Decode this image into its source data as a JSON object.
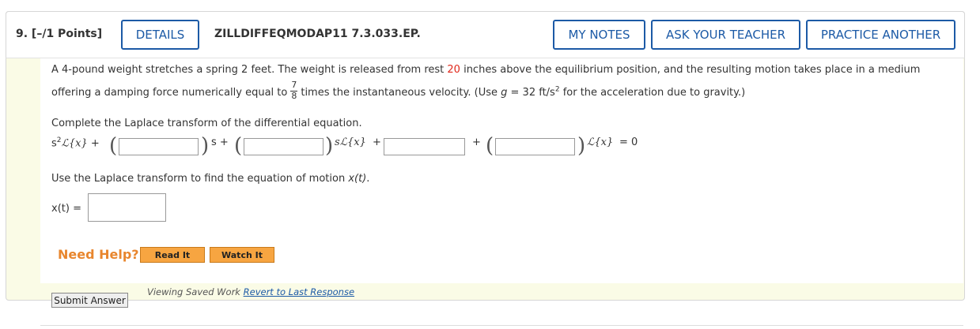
{
  "header": {
    "question_number": "9.  [–/1 Points]",
    "details_label": "DETAILS",
    "problem_code": "ZILLDIFFEQMODAP11 7.3.033.EP.",
    "my_notes_label": "MY NOTES",
    "ask_teacher_label": "ASK YOUR TEACHER",
    "practice_label": "PRACTICE ANOTHER"
  },
  "problem": {
    "line1_a": "A 4-pound weight stretches a spring 2 feet. The weight is released from rest ",
    "line1_value": "20",
    "line1_b": " inches above the equilibrium position, and the resulting motion takes place in a medium",
    "line2_a": "offering a damping force numerically equal to",
    "frac_num": "7",
    "frac_den": "8",
    "line2_b": "times the instantaneous velocity. (Use ",
    "g_var": "g",
    "line2_c": " = 32 ft/s",
    "line2_exp": "2",
    "line2_d": " for the acceleration due to gravity.)"
  },
  "part1": {
    "prompt": "Complete the Laplace transform of the differential equation.",
    "term_s2": "s",
    "term_s2_exp": "2",
    "term_L": "ℒ{x}",
    "plus": "+",
    "term_s": "s +",
    "term_sL": "sℒ{x}",
    "term_L2": "ℒ{x}",
    "equals": "= 0"
  },
  "part2": {
    "prompt_a": "Use the Laplace transform to find the equation of motion ",
    "prompt_var": "x(t)",
    "prompt_end": ".",
    "answer_label": "x(t)  ="
  },
  "help": {
    "label": "Need Help?",
    "read_it": "Read It",
    "watch_it": "Watch It"
  },
  "footer": {
    "submit_label": "Submit Answer",
    "saved_text": "Viewing Saved Work ",
    "revert_link": "Revert to Last Response"
  },
  "colors": {
    "accent_blue": "#1c5aa6",
    "red_value": "#e0281b",
    "help_orange": "#e8862e"
  }
}
